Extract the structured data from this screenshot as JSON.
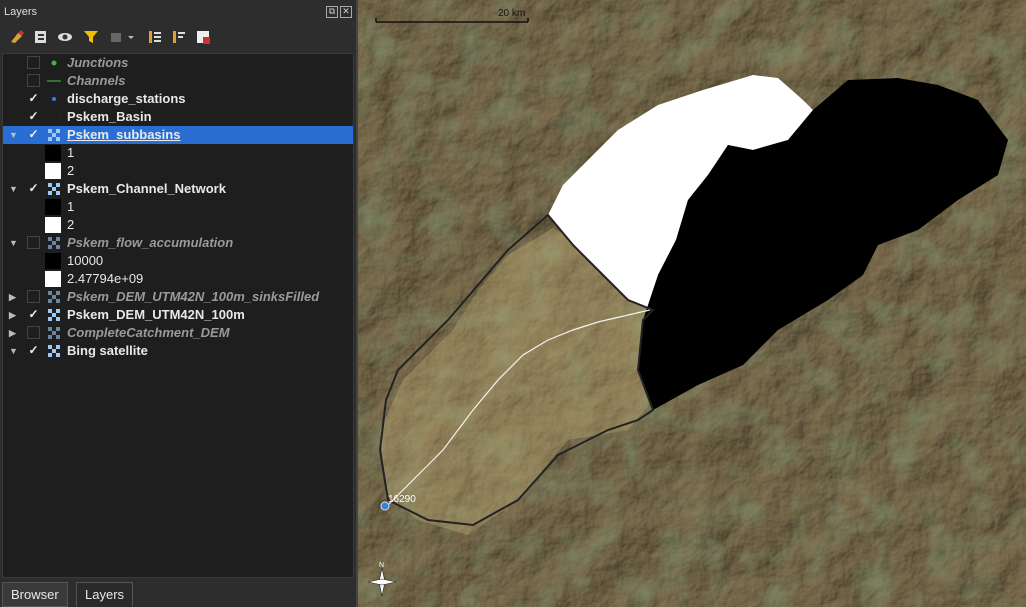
{
  "panel": {
    "title": "Layers"
  },
  "toolbar": {
    "items": [
      "style-icon",
      "add-group-icon",
      "eye-icon",
      "filter-icon",
      "legend-icon",
      "expand-all-icon",
      "collapse-all-icon",
      "remove-layer-icon"
    ]
  },
  "layers": [
    {
      "name": "Junctions",
      "checked": false,
      "dim": true
    },
    {
      "name": "Channels",
      "checked": false,
      "dim": true
    },
    {
      "name": "discharge_stations",
      "checked": true
    },
    {
      "name": "Pskem_Basin",
      "checked": true
    },
    {
      "name": "Pskem_subbasins",
      "checked": true,
      "selected": true,
      "legend": [
        "1",
        "2"
      ]
    },
    {
      "name": "Pskem_Channel_Network",
      "checked": true,
      "legend": [
        "1",
        "2"
      ]
    },
    {
      "name": "Pskem_flow_accumulation",
      "checked": false,
      "dim": true,
      "legend": [
        "10000",
        "2.47794e+09"
      ]
    },
    {
      "name": "Pskem_DEM_UTM42N_100m_sinksFilled",
      "checked": false,
      "dim": true
    },
    {
      "name": "Pskem_DEM_UTM42N_100m",
      "checked": true
    },
    {
      "name": "CompleteCatchment_DEM",
      "checked": false,
      "dim": true
    },
    {
      "name": "Bing satellite",
      "checked": true
    }
  ],
  "tabs": {
    "browser": "Browser",
    "layers": "Layers"
  },
  "map": {
    "scale_label": "20 km",
    "station_label": "16290",
    "north_label": "N"
  },
  "colors": {
    "selection": "#2a6ed4",
    "panel": "#2d2d2d",
    "tree": "#1e1e1e",
    "channel": "#ffffff",
    "basin_outline": "#222222",
    "station": "#3b7fd6"
  }
}
